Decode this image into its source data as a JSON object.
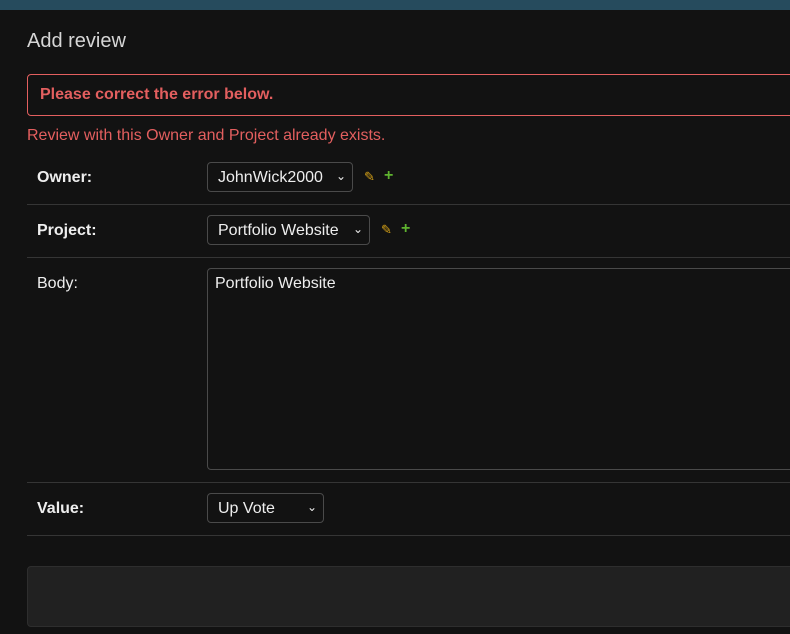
{
  "page": {
    "title": "Add review"
  },
  "errors": {
    "note": "Please correct the error below.",
    "nonfield": "Review with this Owner and Project already exists."
  },
  "fields": {
    "owner": {
      "label": "Owner:",
      "value": "JohnWick2000"
    },
    "project": {
      "label": "Project:",
      "value": "Portfolio Website"
    },
    "body": {
      "label": "Body:",
      "value": "Portfolio Website"
    },
    "value": {
      "label": "Value:",
      "value": "Up Vote"
    }
  },
  "icons": {
    "edit": "pencil-icon",
    "add": "plus-icon",
    "dropdown": "chevron-down-icon"
  },
  "colors": {
    "header": "#264b5d",
    "error": "#e35f5f",
    "edit_icon": "#d4a017",
    "add_icon": "#5fb32f"
  }
}
